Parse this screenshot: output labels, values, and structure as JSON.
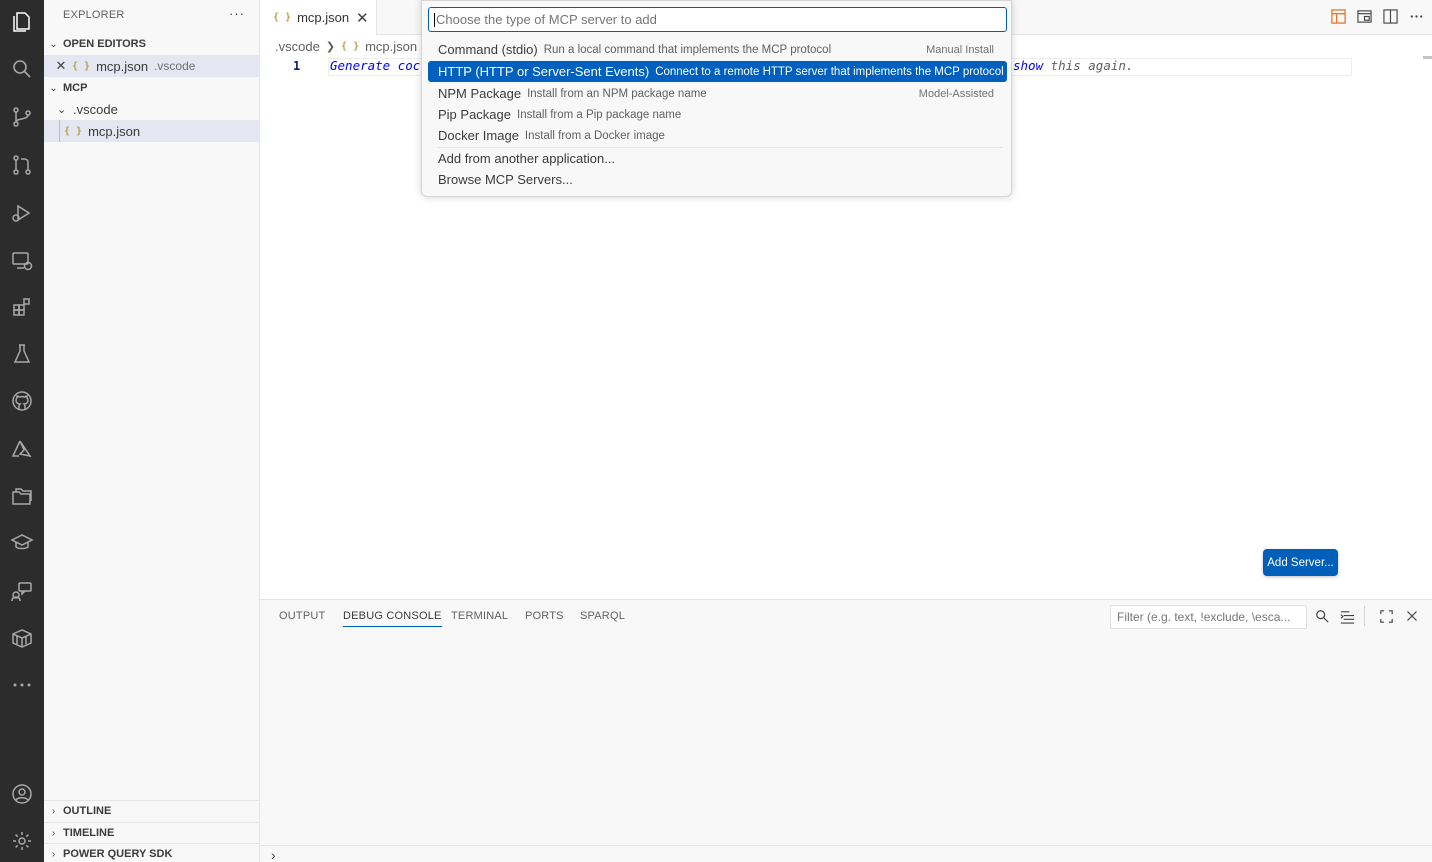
{
  "explorer": {
    "title": "EXPLORER",
    "more": "···",
    "open_editors": {
      "label": "OPEN EDITORS",
      "items": [
        {
          "name": "mcp.json",
          "desc": ".vscode"
        }
      ]
    },
    "workspace": {
      "label": "MCP",
      "folder": ".vscode",
      "file": "mcp.json"
    },
    "bottom_sections": [
      "OUTLINE",
      "TIMELINE",
      "POWER QUERY SDK"
    ]
  },
  "tab": {
    "label": "mcp.json"
  },
  "breadcrumb": {
    "folder": ".vscode",
    "file": "mcp.json"
  },
  "editor": {
    "line_number": "1",
    "ghost_left": "Generate coc",
    "ghost_right_kw": "show",
    "ghost_right_rest": " this again."
  },
  "add_server_button": "Add Server...",
  "quickpick": {
    "placeholder": "Choose the type of MCP server to add",
    "items": [
      {
        "title": "Command (stdio)",
        "detail": "Run a local command that implements the MCP protocol",
        "right": "Manual Install"
      },
      {
        "title": "HTTP (HTTP or Server-Sent Events)",
        "detail": "Connect to a remote HTTP server that implements the MCP protocol",
        "right": ""
      },
      {
        "title": "NPM Package",
        "detail": "Install from an NPM package name",
        "right": "Model-Assisted"
      },
      {
        "title": "Pip Package",
        "detail": "Install from a Pip package name",
        "right": ""
      },
      {
        "title": "Docker Image",
        "detail": "Install from a Docker image",
        "right": ""
      },
      {
        "title": "Add from another application...",
        "detail": "",
        "right": ""
      },
      {
        "title": "Browse MCP Servers...",
        "detail": "",
        "right": ""
      }
    ]
  },
  "panel": {
    "tabs": [
      "OUTPUT",
      "DEBUG CONSOLE",
      "TERMINAL",
      "PORTS",
      "SPARQL"
    ],
    "active_tab": "DEBUG CONSOLE",
    "filter_placeholder": "Filter (e.g. text, !exclude, \\esca...",
    "prompt": "›"
  },
  "colors": {
    "accent": "#005fb8",
    "selection": "#0060c0",
    "activity_bar": "#2c2c2c"
  }
}
